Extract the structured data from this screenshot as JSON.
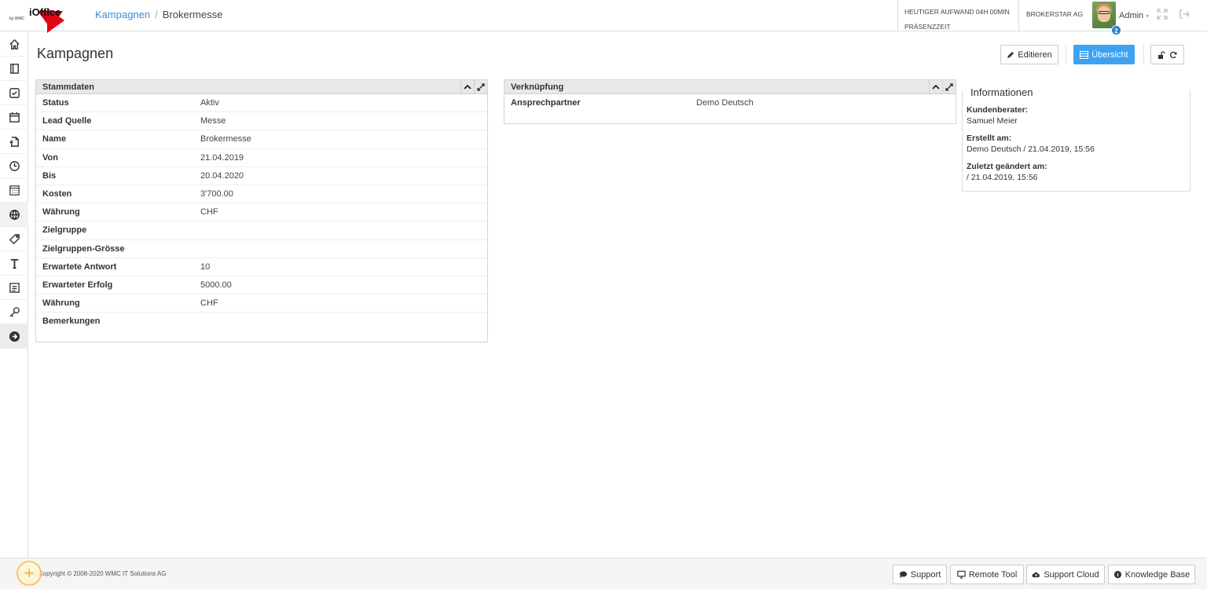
{
  "brand": {
    "name": "iOffice",
    "sub": "by WMC"
  },
  "breadcrumb": {
    "parent": "Kampagnen",
    "current": "Brokermesse",
    "separator": "/"
  },
  "header": {
    "effort_label": "HEUTIGER AUFWAND 04H 00MIN",
    "presence_label": "PRÄSENZZEIT",
    "company": "BROKERSTAR AG",
    "user": "Admin",
    "notification_count": "2"
  },
  "sidebar": {
    "items": [
      {
        "name": "home-icon"
      },
      {
        "name": "book-icon"
      },
      {
        "name": "check-icon"
      },
      {
        "name": "calendar-icon"
      },
      {
        "name": "document-export-icon"
      },
      {
        "name": "clock-icon"
      },
      {
        "name": "calculator-icon"
      },
      {
        "name": "globe-icon"
      },
      {
        "name": "tag-icon"
      },
      {
        "name": "text-icon"
      },
      {
        "name": "form-icon"
      },
      {
        "name": "key-icon"
      },
      {
        "name": "arrow-right-circle-icon"
      }
    ],
    "active_index": 7
  },
  "page": {
    "title": "Kampagnen"
  },
  "actions": {
    "edit": "Editieren",
    "overview": "Übersicht"
  },
  "stammdaten": {
    "title": "Stammdaten",
    "rows": [
      {
        "label": "Status",
        "value": "Aktiv"
      },
      {
        "label": "Lead Quelle",
        "value": "Messe"
      },
      {
        "label": "Name",
        "value": "Brokermesse"
      },
      {
        "label": "Von",
        "value": "21.04.2019"
      },
      {
        "label": "Bis",
        "value": "20.04.2020"
      },
      {
        "label": "Kosten",
        "value": "3'700.00"
      },
      {
        "label": "Währung",
        "value": "CHF"
      },
      {
        "label": "Zielgruppe",
        "value": ""
      },
      {
        "label": "Zielgruppen-Grösse",
        "value": ""
      },
      {
        "label": "Erwartete Antwort",
        "value": "10"
      },
      {
        "label": "Erwarteter Erfolg",
        "value": "5000.00"
      },
      {
        "label": "Währung",
        "value": "CHF"
      },
      {
        "label": "Bemerkungen",
        "value": ""
      }
    ]
  },
  "verknuepfung": {
    "title": "Verknüpfung",
    "rows": [
      {
        "label": "Ansprechpartner",
        "value": "Demo Deutsch"
      }
    ]
  },
  "informationen": {
    "title": "Informationen",
    "advisor_label": "Kundenberater:",
    "advisor": "Samuel Meier",
    "created_label": "Erstellt am:",
    "created": "Demo Deutsch / 21.04.2019, 15:56",
    "modified_label": "Zuletzt geändert am:",
    "modified": "/ 21.04.2019, 15:56"
  },
  "footer": {
    "copyright": "iOffice Copyright © 2008-2020 WMC IT Solutions AG",
    "buttons": {
      "support": "Support",
      "remote": "Remote Tool",
      "cloud": "Support Cloud",
      "kb": "Knowledge Base"
    }
  },
  "colors": {
    "accent": "#3da2f2",
    "link": "#3a8fd8",
    "brand_red": "#e30613"
  }
}
